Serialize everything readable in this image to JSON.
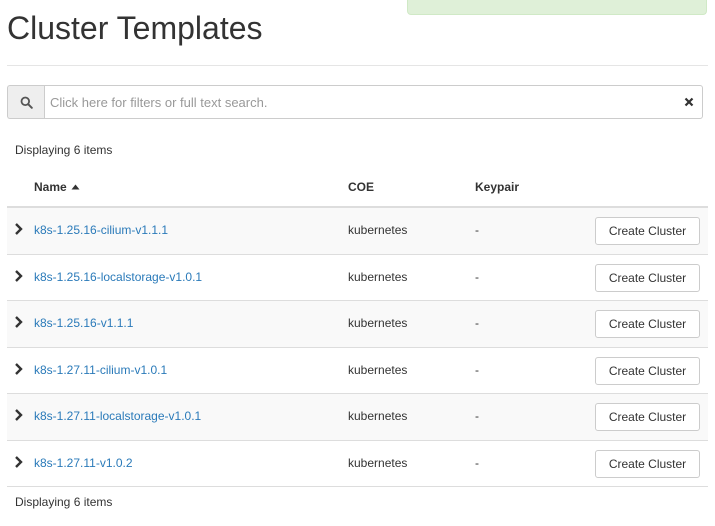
{
  "page": {
    "title": "Cluster Templates"
  },
  "search": {
    "placeholder": "Click here for filters or full text search.",
    "value": ""
  },
  "icons": {
    "search": "search-icon",
    "clear": "close-icon",
    "expand": "chevron-right-icon",
    "sort": "sort-asc-icon"
  },
  "colors": {
    "link": "#2a7ab9",
    "alert_bg": "#dff0d8",
    "row_stripe": "#f9f9f9"
  },
  "table": {
    "count_top": "Displaying 6 items",
    "count_bottom": "Displaying 6 items",
    "columns": {
      "name": "Name",
      "coe": "COE",
      "keypair": "Keypair"
    },
    "sort": {
      "column": "Name",
      "direction": "ascending"
    },
    "rows": [
      {
        "name": "k8s-1.25.16-cilium-v1.1.1",
        "coe": "kubernetes",
        "keypair": "-",
        "action": "Create Cluster"
      },
      {
        "name": "k8s-1.25.16-localstorage-v1.0.1",
        "coe": "kubernetes",
        "keypair": "-",
        "action": "Create Cluster"
      },
      {
        "name": "k8s-1.25.16-v1.1.1",
        "coe": "kubernetes",
        "keypair": "-",
        "action": "Create Cluster"
      },
      {
        "name": "k8s-1.27.11-cilium-v1.0.1",
        "coe": "kubernetes",
        "keypair": "-",
        "action": "Create Cluster"
      },
      {
        "name": "k8s-1.27.11-localstorage-v1.0.1",
        "coe": "kubernetes",
        "keypair": "-",
        "action": "Create Cluster"
      },
      {
        "name": "k8s-1.27.11-v1.0.2",
        "coe": "kubernetes",
        "keypair": "-",
        "action": "Create Cluster"
      }
    ]
  }
}
